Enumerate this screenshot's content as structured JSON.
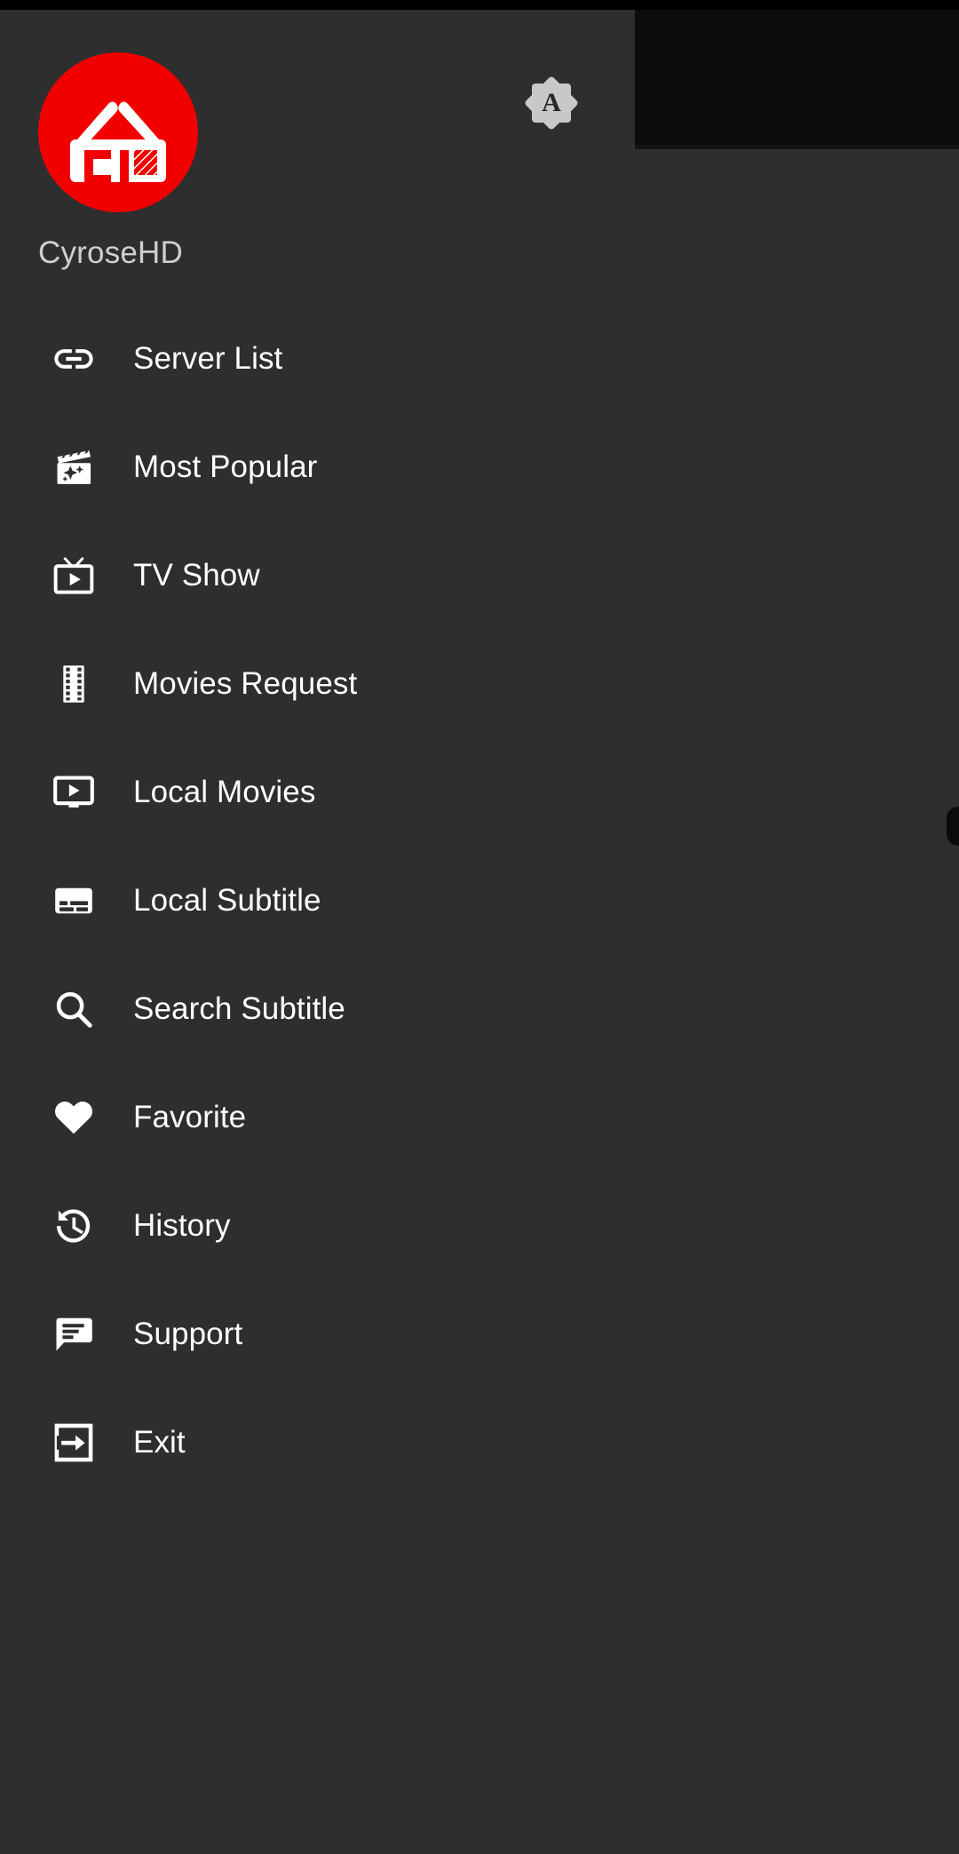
{
  "statusbar": {
    "background": "#000000"
  },
  "drawer": {
    "background": "#2e2e2e",
    "logo": {
      "icon": "chd-3d-glasses-logo",
      "circle_color": "#f20000",
      "mark_color": "#ffffff"
    },
    "avatar": {
      "icon": "account-badge-star",
      "letter": "A",
      "badge_color": "#c8c8c8",
      "letter_color": "#262626"
    },
    "app_name": "CyroseHD",
    "menu": [
      {
        "icon": "link-icon",
        "label": "Server List"
      },
      {
        "icon": "clapperboard-star-icon",
        "label": "Most Popular"
      },
      {
        "icon": "tv-play-icon",
        "label": "TV Show"
      },
      {
        "icon": "film-strip-icon",
        "label": "Movies Request"
      },
      {
        "icon": "monitor-play-icon",
        "label": "Local Movies"
      },
      {
        "icon": "subtitles-icon",
        "label": "Local Subtitle"
      },
      {
        "icon": "search-icon",
        "label": "Search Subtitle"
      },
      {
        "icon": "heart-icon",
        "label": "Favorite"
      },
      {
        "icon": "history-clock-icon",
        "label": "History"
      },
      {
        "icon": "chat-message-icon",
        "label": "Support"
      },
      {
        "icon": "exit-arrow-icon",
        "label": "Exit"
      }
    ]
  },
  "scrim": {
    "background": "#0d0d0d",
    "toolbar": [
      {
        "icon": "sort-lines-icon",
        "label": ""
      },
      {
        "icon": "search-icon",
        "label": ""
      }
    ]
  }
}
